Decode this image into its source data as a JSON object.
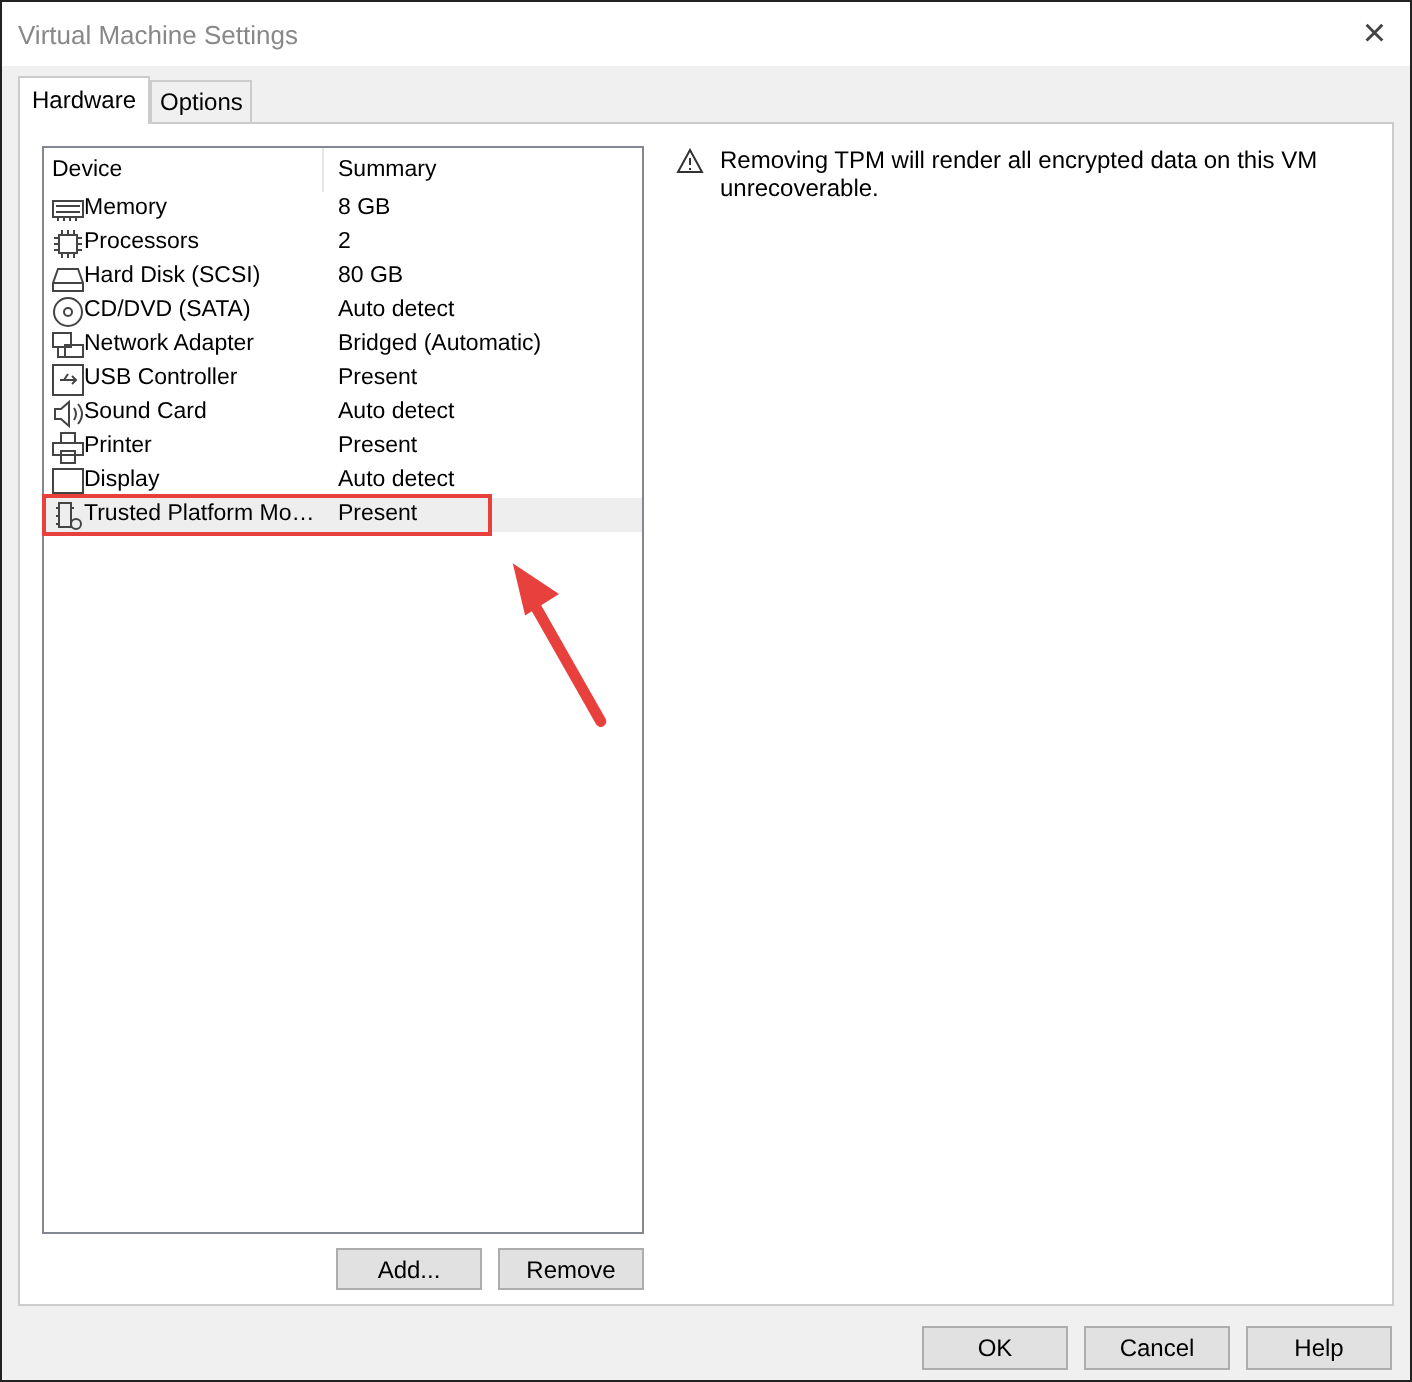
{
  "window": {
    "title": "Virtual Machine Settings",
    "close": "×"
  },
  "tabs": [
    {
      "label": "Hardware",
      "selected": true
    },
    {
      "label": "Options",
      "selected": false
    }
  ],
  "device_table": {
    "columns": [
      "Device",
      "Summary"
    ],
    "rows": [
      {
        "kind": "memory",
        "device": "Memory",
        "summary": "8 GB",
        "selected": false
      },
      {
        "kind": "processor",
        "device": "Processors",
        "summary": "2",
        "selected": false
      },
      {
        "kind": "disk",
        "device": "Hard Disk (SCSI)",
        "summary": "80 GB",
        "selected": false
      },
      {
        "kind": "cd",
        "device": "CD/DVD (SATA)",
        "summary": "Auto detect",
        "selected": false
      },
      {
        "kind": "network",
        "device": "Network Adapter",
        "summary": "Bridged (Automatic)",
        "selected": false
      },
      {
        "kind": "usb",
        "device": "USB Controller",
        "summary": "Present",
        "selected": false
      },
      {
        "kind": "sound",
        "device": "Sound Card",
        "summary": "Auto detect",
        "selected": false
      },
      {
        "kind": "printer",
        "device": "Printer",
        "summary": "Present",
        "selected": false
      },
      {
        "kind": "display",
        "device": "Display",
        "summary": "Auto detect",
        "selected": false
      },
      {
        "kind": "tpm",
        "device": "Trusted Platform Mo…",
        "summary": "Present",
        "selected": true
      }
    ]
  },
  "list_buttons": [
    "Add...",
    "Remove"
  ],
  "warning": "Removing TPM will render all encrypted data on this VM unrecoverable.",
  "dialog_buttons": [
    "OK",
    "Cancel",
    "Help"
  ]
}
